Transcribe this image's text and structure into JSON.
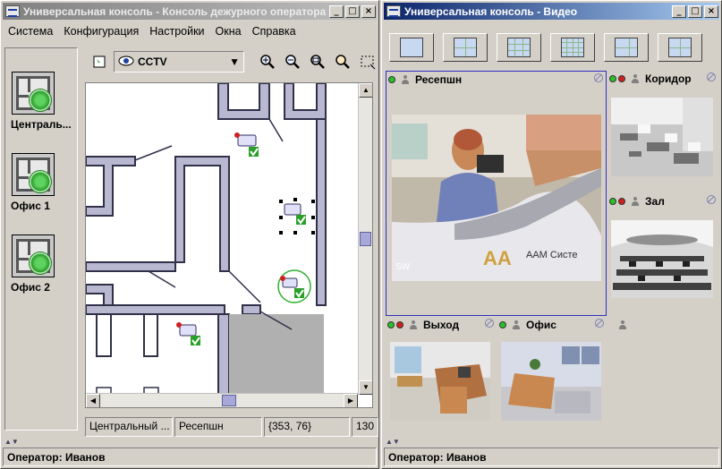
{
  "left_window": {
    "title": "Универсальная консоль - Консоль дежурного оператора",
    "menu": [
      "Система",
      "Конфигурация",
      "Настройки",
      "Окна",
      "Справка"
    ],
    "sites": [
      {
        "label": "Централь..."
      },
      {
        "label": "Офис 1"
      },
      {
        "label": "Офис 2"
      }
    ],
    "layer_combo": "CCTV",
    "toolbar_icons": [
      "layer-icon",
      "eye-icon",
      "zoom-in-icon",
      "zoom-out-icon",
      "zoom-fit-icon",
      "zoom-search-icon",
      "select-rect-icon",
      "pan-hand-icon"
    ],
    "status": {
      "site": "Центральный ...",
      "camera": "Ресепшн",
      "coords": "{353, 76}",
      "zoom": "130"
    },
    "operator": "Оператор: Иванов"
  },
  "right_window": {
    "title": "Универсальная консоль - Видео",
    "layouts": [
      "1x1",
      "2x2",
      "3x3",
      "4x4",
      "1+5",
      "2x2 wide"
    ],
    "cameras": [
      {
        "name": "Ресепшн",
        "status": [
          "green"
        ],
        "overlay": "SW",
        "sign": "ААМ Систе"
      },
      {
        "name": "Коридор",
        "status": [
          "green",
          "red"
        ]
      },
      {
        "name": "Зал",
        "status": [
          "green",
          "red"
        ]
      },
      {
        "name": "Выход",
        "status": [
          "green",
          "red"
        ]
      },
      {
        "name": "Офис",
        "status": [
          "green"
        ]
      },
      {
        "name": "",
        "status": []
      }
    ],
    "operator": "Оператор: Иванов"
  },
  "colors": {
    "window_bg": "#d4d0c8",
    "title_active": "#0a246a",
    "title_inactive": "#808080",
    "wall": "#b8b8d0",
    "selection": "#3030c0",
    "ok_badge": "#2aa02a"
  }
}
